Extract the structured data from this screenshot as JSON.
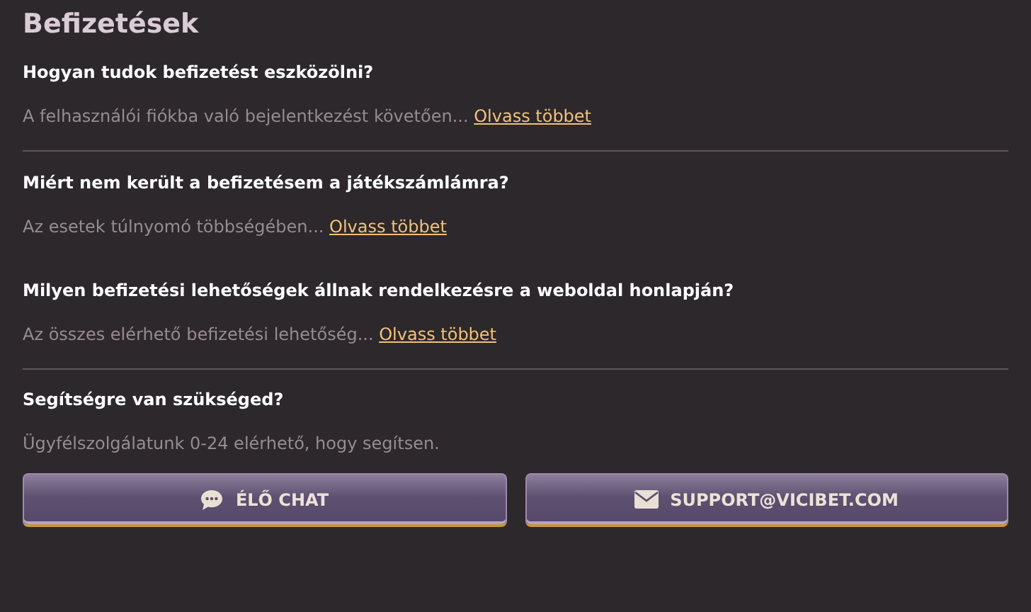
{
  "title": "Befizetések",
  "faq": [
    {
      "question": "Hogyan tudok befizetést eszközölni?",
      "answer": "A felhasználói fiókba való bejelentkezést követően...",
      "link": "Olvass többet",
      "divider_after": true
    },
    {
      "question": "Miért nem került a befizetésem a játékszámlámra?",
      "answer": "Az esetek túlnyomó többségében...",
      "link": "Olvass többet",
      "divider_after": false
    },
    {
      "question": "Milyen befizetési lehetőségek állnak rendelkezésre a weboldal honlapján?",
      "answer": "Az összes elérhető befizetési lehetőség...",
      "link": "Olvass többet",
      "divider_after": true
    }
  ],
  "help": {
    "title": "Segítségre van szükséged?",
    "text": "Ügyfélszolgálatunk 0-24 elérhető, hogy segítsen."
  },
  "buttons": [
    {
      "kind": "chat",
      "label": "ÉLŐ CHAT"
    },
    {
      "kind": "email",
      "label": "SUPPORT@VICIBET.COM"
    }
  ]
}
